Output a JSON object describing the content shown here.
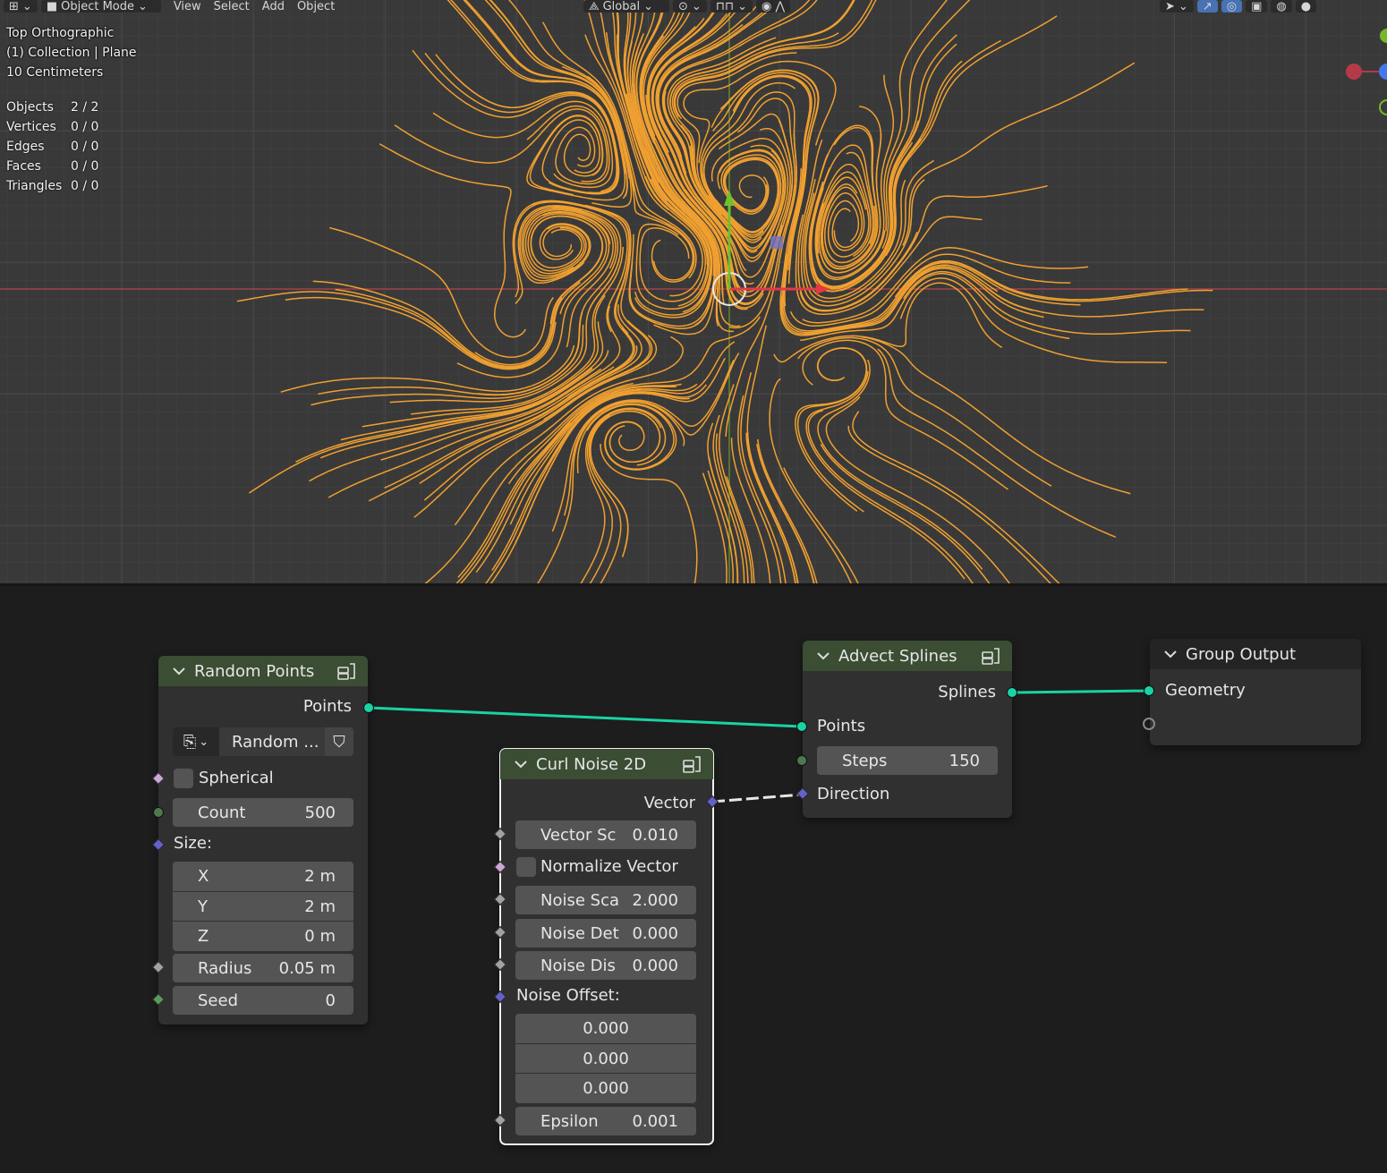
{
  "viewport": {
    "header": {
      "mode_label": "Object Mode",
      "menus": [
        "View",
        "Select",
        "Add",
        "Object"
      ],
      "transform_orientation": "Global"
    },
    "overlay": {
      "view_name": "Top Orthographic",
      "collection": "(1) Collection | Plane",
      "grid_scale": "10 Centimeters"
    },
    "stats": [
      {
        "label": "Objects",
        "value": "2 / 2"
      },
      {
        "label": "Vertices",
        "value": "0 / 0"
      },
      {
        "label": "Edges",
        "value": "0 / 0"
      },
      {
        "label": "Faces",
        "value": "0 / 0"
      },
      {
        "label": "Triangles",
        "value": "0 / 0"
      }
    ],
    "colors": {
      "background": "#393939",
      "curves": "#f0a030",
      "x_axis": "#b5454f",
      "y_axis": "#6d9a2f"
    }
  },
  "nodes": {
    "random_points": {
      "title": "Random Points",
      "output_points": "Points",
      "selector_label": "Random ...",
      "spherical": "Spherical",
      "count_label": "Count",
      "count_value": "500",
      "size_label": "Size:",
      "x_label": "X",
      "x_value": "2 m",
      "y_label": "Y",
      "y_value": "2 m",
      "z_label": "Z",
      "z_value": "0 m",
      "radius_label": "Radius",
      "radius_value": "0.05 m",
      "seed_label": "Seed",
      "seed_value": "0"
    },
    "curl_noise": {
      "title": "Curl Noise 2D",
      "output_vector": "Vector",
      "vector_scale_label": "Vector Sc",
      "vector_scale_value": "0.010",
      "normalize_label": "Normalize Vector",
      "noise_scale_label": "Noise Sca",
      "noise_scale_value": "2.000",
      "noise_detail_label": "Noise Det",
      "noise_detail_value": "0.000",
      "noise_distortion_label": "Noise Dis",
      "noise_distortion_value": "0.000",
      "noise_offset_label": "Noise Offset:",
      "offset_x": "0.000",
      "offset_y": "0.000",
      "offset_z": "0.000",
      "epsilon_label": "Epsilon",
      "epsilon_value": "0.001"
    },
    "advect_splines": {
      "title": "Advect Splines",
      "output_splines": "Splines",
      "input_points": "Points",
      "steps_label": "Steps",
      "steps_value": "150",
      "input_direction": "Direction"
    },
    "group_output": {
      "title": "Group Output",
      "input_geometry": "Geometry"
    }
  },
  "colors": {
    "geometry_socket": "#19d3a3",
    "vector_socket": "#6363c7",
    "node_header_group": "#3b4d33",
    "editor_bg": "#1d1d1d"
  }
}
